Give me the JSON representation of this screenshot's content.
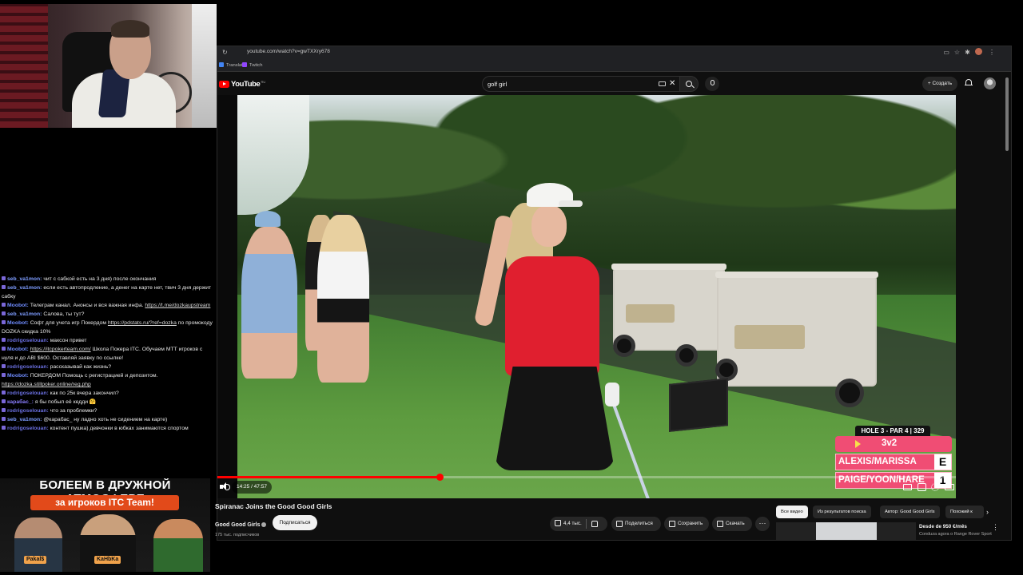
{
  "browser": {
    "url": "youtube.com/watch?v=gwTXXry678",
    "bookmarks": [
      {
        "label": "Translate",
        "color": "#4285f4"
      },
      {
        "label": "Twitch",
        "color": "#9146ff"
      }
    ]
  },
  "youtube": {
    "logo_text": "YouTube",
    "logo_region": "RU",
    "search_query": "golf girl",
    "create_label": "+ Создать"
  },
  "video": {
    "title": "Spiranac Joins the Good Good Girls",
    "time_display": "14:25 / 47:57",
    "progress": 0.3007,
    "scoreboard": {
      "hole": "HOLE 3 - PAR 4 | 329",
      "match": "3v2",
      "team_a": "ALEXIS/MARISSA",
      "team_a_score": "E",
      "team_b": "PAIGE/YOON/HARE",
      "team_b_score": "1"
    }
  },
  "channel": {
    "name": "Good Good Girls",
    "subscribers": "175 тыс. подписчиков",
    "subscribe_label": "Подписаться"
  },
  "actions": {
    "likes": "4,4 тыс.",
    "share": "Поделиться",
    "save": "Сохранить",
    "download": "Скачать",
    "more": "···"
  },
  "chips": [
    "Все видео",
    "Из результатов поиска",
    "Автор: Good Good Girls",
    "Похожий к"
  ],
  "recommendation": {
    "title": "Desde de 950 €/mês",
    "subtitle": "Conduza agora o Range Rover Sport"
  },
  "chat": [
    {
      "nick": "seb_va1mon:",
      "color": "#7d9cff",
      "text": "чит с сабкой есть на 3 дня) после окончания"
    },
    {
      "nick": "seb_va1mon:",
      "color": "#7d9cff",
      "text": "если есть автопродление, а денег на карте нет, твич 3 дня держит сабку"
    },
    {
      "nick": "Moobot:",
      "color": "#6f8cff",
      "text": "Телеграм канал. Анонсы и вся важная инфа.",
      "link": "https://t.me/dozkaupstream"
    },
    {
      "nick": "seb_va1mon:",
      "color": "#7d9cff",
      "text": "Салова, ты тут?"
    },
    {
      "nick": "Moobot:",
      "color": "#6f8cff",
      "text": "Софт для учета игр Покердом",
      "link": "https://pdstats.ru/?ref=dozka",
      "after": "по промокоду DOZKA скидка 10%"
    },
    {
      "nick": "rodrigoselouan:",
      "color": "#6a6fe0",
      "text": "максон привет"
    },
    {
      "nick": "Moobot:",
      "color": "#6f8cff",
      "text": "",
      "link": "https://itcpokerteam.com/",
      "after": "Школа Покера ITC. Обучаем МТТ игроков с нуля и до ABI $600. Оставляй заявку по ссылке!"
    },
    {
      "nick": "rodrigoselouan:",
      "color": "#6a6fe0",
      "text": "рассказывай как жизнь?"
    },
    {
      "nick": "Moobot:",
      "color": "#6f8cff",
      "text": "ПОКЕРДОМ Помощь с регистрацией и депозитом.",
      "link": "https://dozka.stillpoker.online/reg.php"
    },
    {
      "nick": "rodrigoselouan:",
      "color": "#6a6fe0",
      "text": "как по 25к вчера закончил?"
    },
    {
      "nick": "карабас_:",
      "color": "#8a7dff",
      "text": "я бы побыл её кедди 🤗"
    },
    {
      "nick": "rodrigoselouan:",
      "color": "#6a6fe0",
      "text": "что за проблемки?"
    },
    {
      "nick": "seb_va1mon:",
      "color": "#7d9cff",
      "text": "@карабас_ ну ладно хоть не сидением на карте)"
    },
    {
      "nick": "rodrigoselouan:",
      "color": "#6a6fe0",
      "text": "контент пушка) девчонки в юбках занимаются спортом"
    }
  ],
  "banner": {
    "headline": "БОЛЕЕМ В ДРУЖНОЙ АТМОСФЕРЕ",
    "promo": "за игроков ITC Team!",
    "tags": [
      "Pakal$",
      "KaHbKa",
      "..."
    ]
  },
  "colors": {
    "youtube_red": "#ff0000",
    "dark_bg": "#0f0f0f",
    "scoreboard_pink": "#f04d74"
  }
}
